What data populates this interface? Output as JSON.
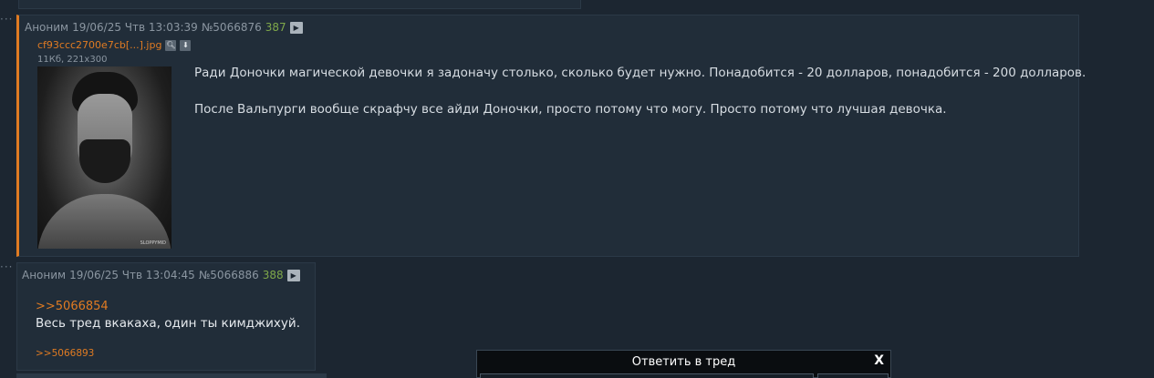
{
  "posts": [
    {
      "author": "Аноним",
      "date": "19/06/25 Чтв 13:03:39",
      "post_id": "№5066876",
      "count": "387",
      "file": {
        "name": "cf93ccc2700e7cb[...].jpg",
        "meta": "11Кб, 221x300",
        "watermark": "SLOPPYMID"
      },
      "paragraphs": [
        "Ради Доночки магической девочки я задоначу столько, сколько будет нужно. Понадобится - 20 долларов, понадобится - 200 долларов.",
        "После Вальпурги вообще скрафчу все айди Доночки, просто потому что могу. Просто потому что лучшая девочка."
      ]
    },
    {
      "author": "Аноним",
      "date": "19/06/25 Чтв 13:04:45",
      "post_id": "№5066886",
      "count": "388",
      "quote": ">>5066854",
      "text": "Весь тред вкакаха, один ты кимджихуй.",
      "backlink": ">>5066893"
    }
  ],
  "reply": {
    "title": "Ответить в тред",
    "close": "X"
  },
  "colors": {
    "background": "#1c2631",
    "post_bg": "#212d39",
    "accent": "#e07b22",
    "count": "#7fa84a"
  }
}
